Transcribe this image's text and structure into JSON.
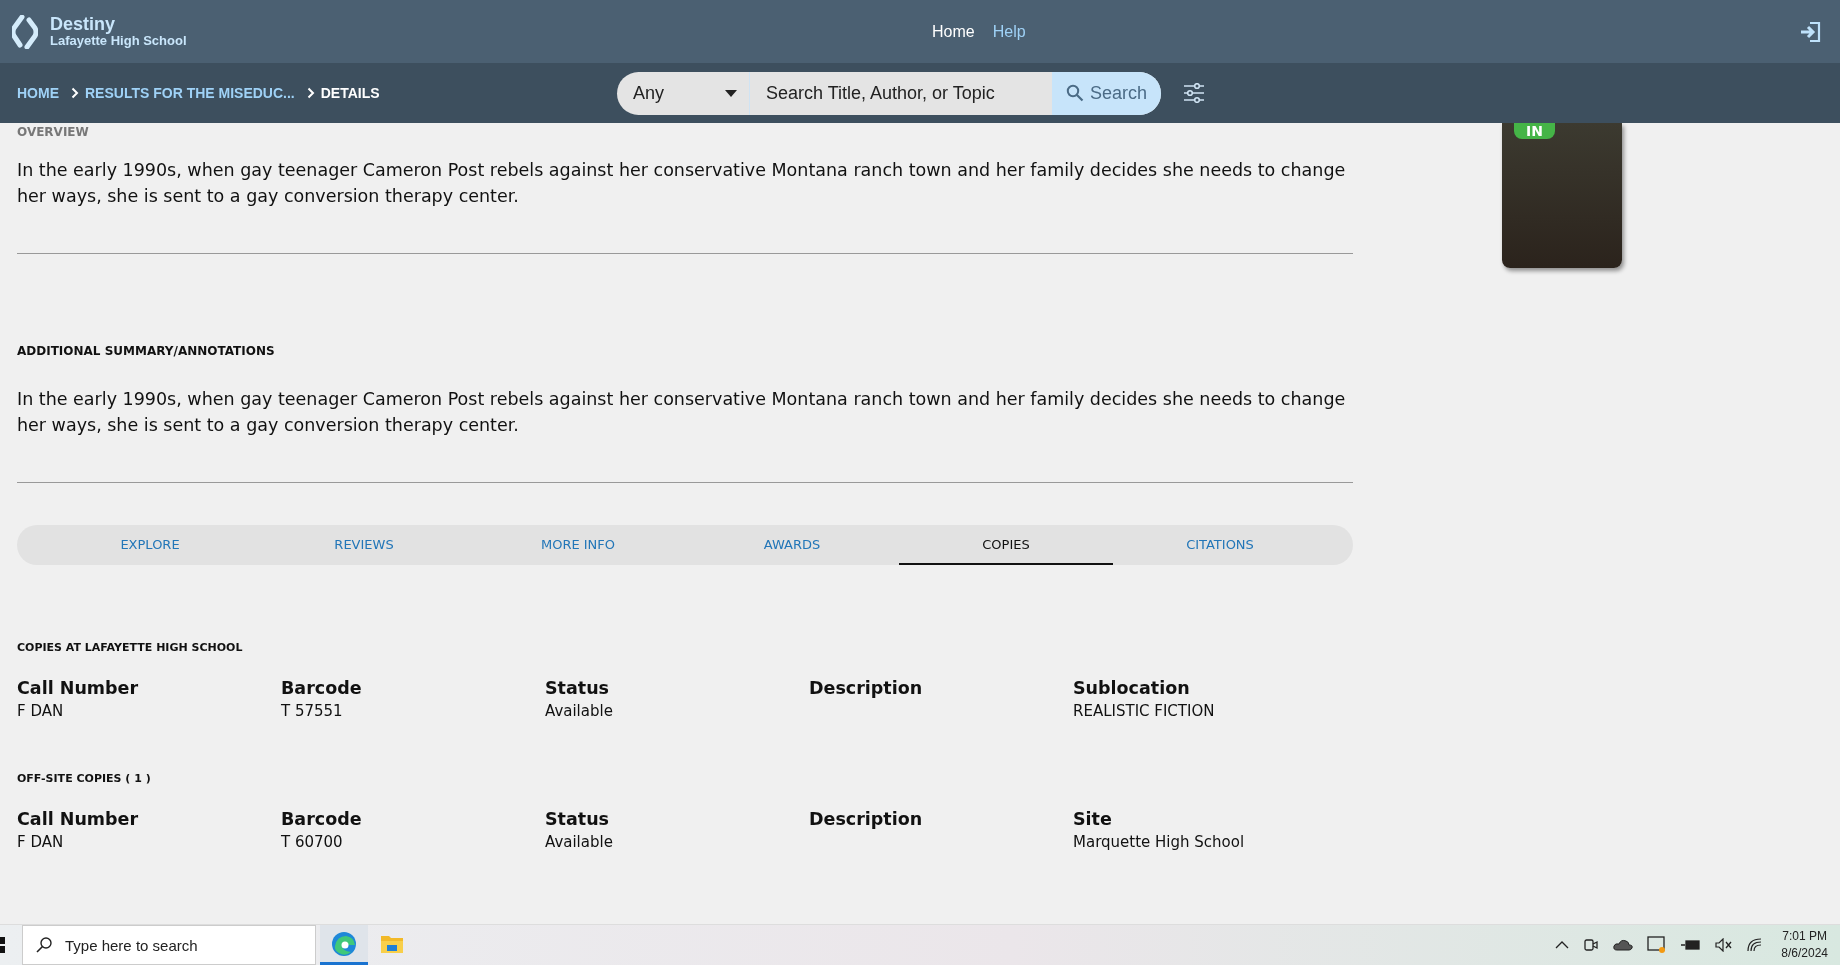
{
  "header": {
    "app_name": "Destiny",
    "site": "Lafayette High School",
    "nav": [
      {
        "label": "Home",
        "selected": true
      },
      {
        "label": "Help",
        "selected": false
      }
    ]
  },
  "breadcrumbs": [
    "HOME",
    "RESULTS FOR THE MISEDUC...",
    "DETAILS"
  ],
  "search": {
    "scope": "Any",
    "placeholder": "Search Title, Author, or Topic",
    "button": "Search"
  },
  "cover": {
    "badge": "IN"
  },
  "sections": [
    {
      "heading": "OVERVIEW",
      "text": "In the early 1990s, when gay teenager Cameron Post rebels against her conservative Montana ranch town and her family decides she needs to change her ways, she is sent to a gay conversion therapy center."
    },
    {
      "heading": "ADDITIONAL SUMMARY/ANNOTATIONS",
      "text": "In the early 1990s, when gay teenager Cameron Post rebels against her conservative Montana ranch town and her family decides she needs to change her ways, she is sent to a gay conversion therapy center."
    }
  ],
  "tabs": [
    {
      "label": "EXPLORE",
      "selected": false
    },
    {
      "label": "REVIEWS",
      "selected": false
    },
    {
      "label": "MORE INFO",
      "selected": false
    },
    {
      "label": "AWARDS",
      "selected": false
    },
    {
      "label": "COPIES",
      "selected": true
    },
    {
      "label": "CITATIONS",
      "selected": false
    }
  ],
  "copy_groups": [
    {
      "heading": "COPIES AT LAFAYETTE HIGH SCHOOL",
      "columns": [
        {
          "header": "Call Number",
          "value": "F DAN"
        },
        {
          "header": "Barcode",
          "value": "T 57551"
        },
        {
          "header": "Status",
          "value": "Available"
        },
        {
          "header": "Description"
        },
        {
          "header": "Sublocation",
          "value": "REALISTIC FICTION"
        }
      ]
    },
    {
      "heading": "OFF-SITE COPIES ( 1 )",
      "columns": [
        {
          "header": "Call Number",
          "value": "F DAN"
        },
        {
          "header": "Barcode",
          "value": "T 60700"
        },
        {
          "header": "Status",
          "value": "Available"
        },
        {
          "header": "Description"
        },
        {
          "header": "Site",
          "value": "Marquette High School"
        }
      ]
    }
  ],
  "taskbar": {
    "search_placeholder": "Type here to search",
    "time": "7:01 PM",
    "date": "8/6/2024"
  }
}
